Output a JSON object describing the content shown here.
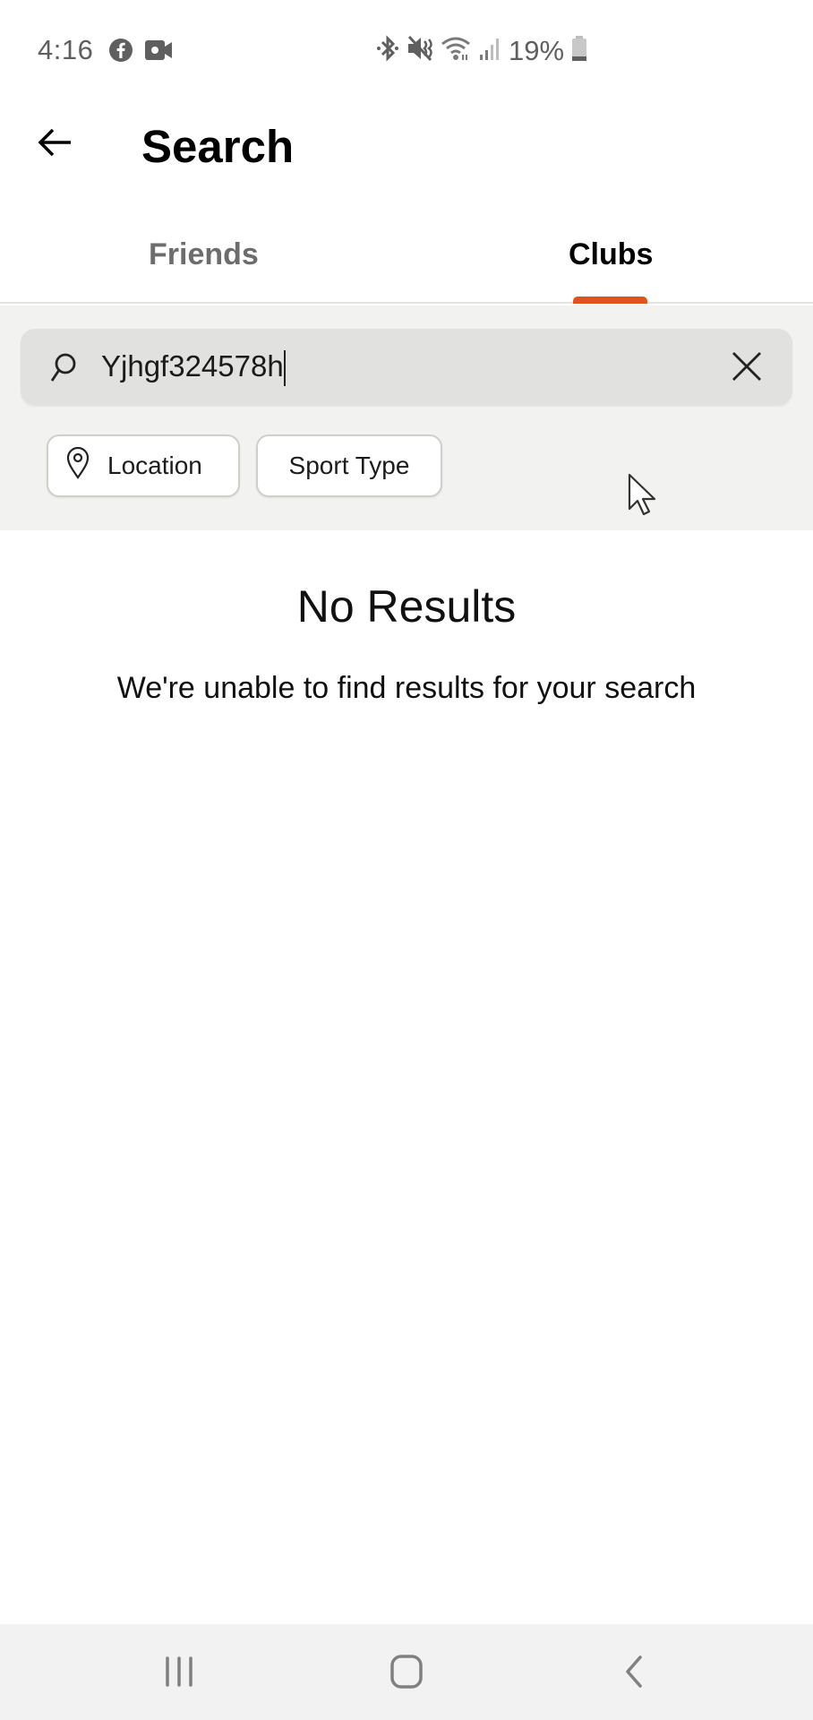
{
  "status_bar": {
    "time": "4:16",
    "left_icons": [
      "facebook-icon",
      "video-call-icon"
    ],
    "right_icons": [
      "bluetooth-icon",
      "mute-icon",
      "wifi-icon",
      "signal-icon"
    ],
    "battery_percent": "19%"
  },
  "header": {
    "back_icon": "arrow-left-icon",
    "title": "Search"
  },
  "tabs": [
    {
      "label": "Friends",
      "active": false
    },
    {
      "label": "Clubs",
      "active": true
    }
  ],
  "accent_color": "#e0531c",
  "search": {
    "value": "Yjhgf324578h",
    "icon": "search-icon",
    "clear_icon": "close-icon"
  },
  "filters": [
    {
      "label": "Location",
      "icon": "location-pin-icon"
    },
    {
      "label": "Sport Type"
    }
  ],
  "empty_state": {
    "title": "No Results",
    "subtitle": "We're unable to find results for your search"
  },
  "nav_bar": {
    "buttons": [
      "recent-apps",
      "home",
      "back"
    ]
  }
}
